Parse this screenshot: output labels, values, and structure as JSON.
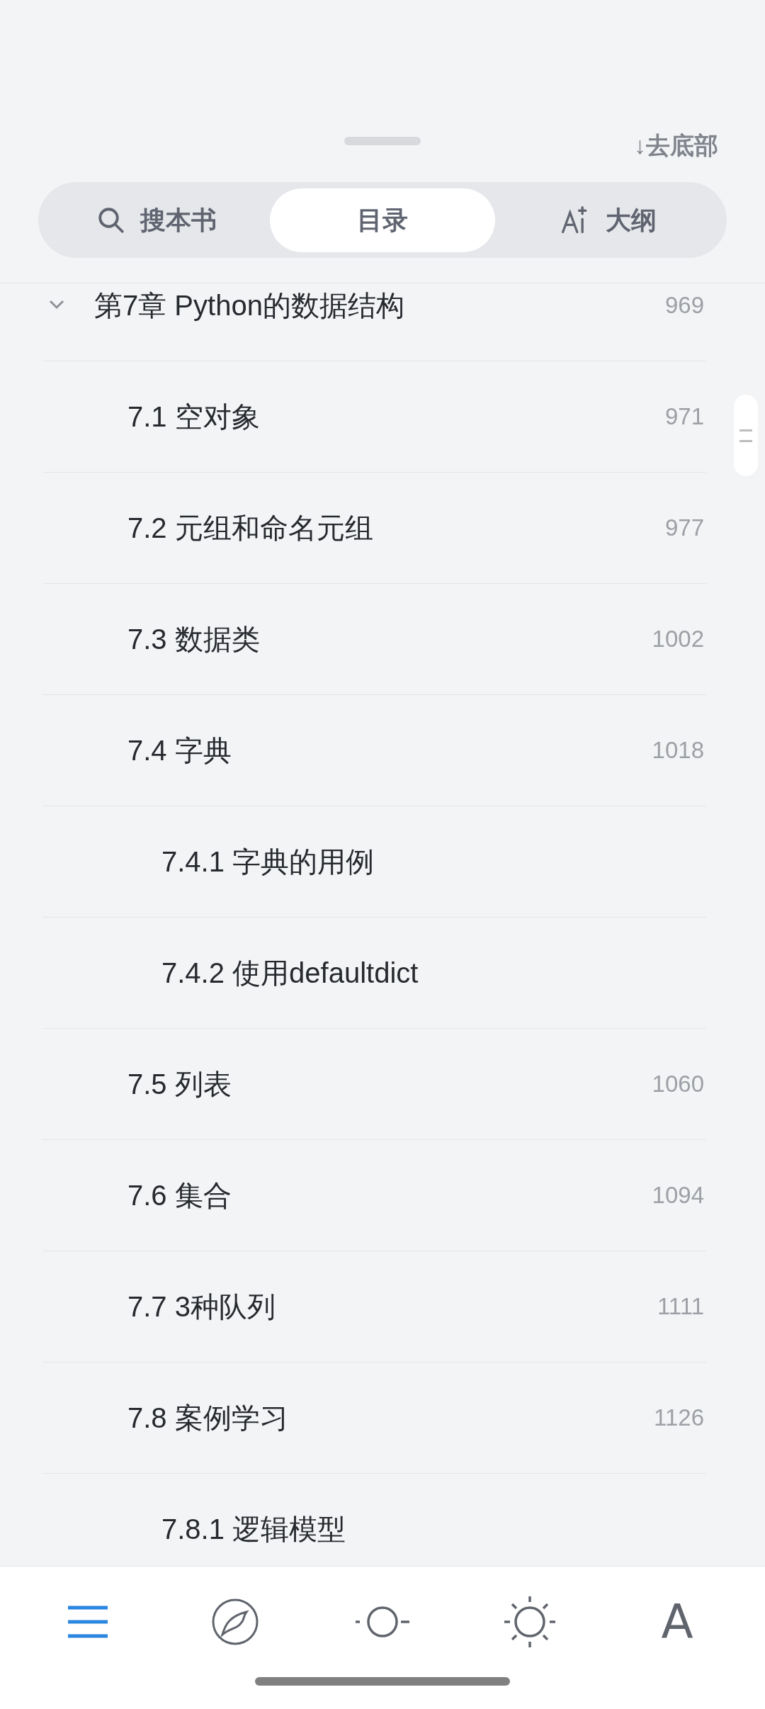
{
  "header": {
    "jump_link": "↓去底部"
  },
  "tabs": [
    {
      "kind": "search",
      "label": "搜本书",
      "selected": false
    },
    {
      "kind": "plain",
      "label": "目录",
      "selected": true
    },
    {
      "kind": "ai",
      "label": "大纲",
      "selected": false
    }
  ],
  "toc": [
    {
      "title": "第7章 Python的数据结构",
      "page": "969",
      "expanded": true,
      "children": [
        {
          "title": "7.1 空对象",
          "page": "971"
        },
        {
          "title": "7.2 元组和命名元组",
          "page": "977"
        },
        {
          "title": "7.3 数据类",
          "page": "1002"
        },
        {
          "title": "7.4 字典",
          "page": "1018",
          "children": [
            {
              "title": "7.4.1 字典的用例"
            },
            {
              "title": "7.4.2 使用defaultdict"
            }
          ]
        },
        {
          "title": "7.5 列表",
          "page": "1060"
        },
        {
          "title": "7.6 集合",
          "page": "1094"
        },
        {
          "title": "7.7 3种队列",
          "page": "1111"
        },
        {
          "title": "7.8 案例学习",
          "page": "1126",
          "children": [
            {
              "title": "7.8.1 逻辑模型"
            }
          ]
        }
      ]
    }
  ],
  "bottom_nav": [
    {
      "kind": "menu",
      "selected": true
    },
    {
      "kind": "compass",
      "selected": false
    },
    {
      "kind": "dim",
      "selected": false
    },
    {
      "kind": "bright",
      "selected": false
    },
    {
      "kind": "font",
      "label": "A",
      "selected": false
    }
  ]
}
